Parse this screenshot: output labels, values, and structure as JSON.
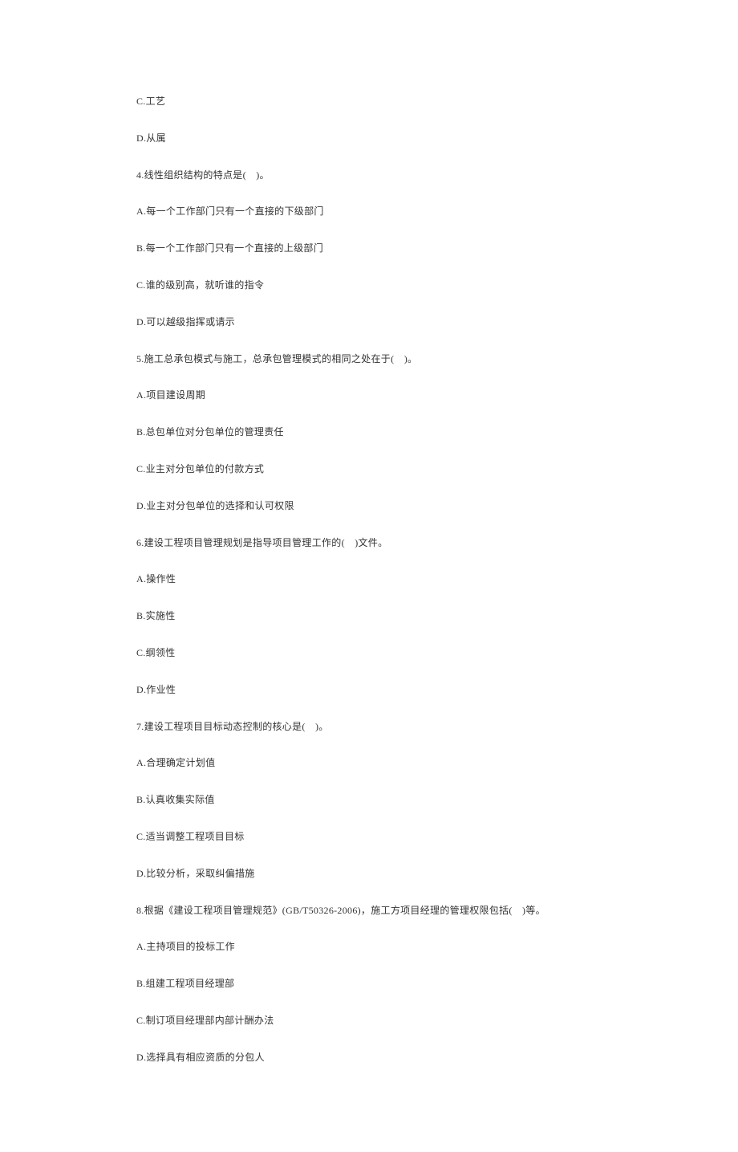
{
  "lines": [
    "C.工艺",
    "D.从属",
    "4.线性组织结构的特点是(　)。",
    "A.每一个工作部门只有一个直接的下级部门",
    "B.每一个工作部门只有一个直接的上级部门",
    "C.谁的级别高，就听谁的指令",
    "D.可以越级指挥或请示",
    "5.施工总承包模式与施工，总承包管理模式的相同之处在于(　)。",
    "A.项目建设周期",
    "B.总包单位对分包单位的管理责任",
    "C.业主对分包单位的付款方式",
    "D.业主对分包单位的选择和认可权限",
    "6.建设工程项目管理规划是指导项目管理工作的(　)文件。",
    "A.操作性",
    "B.实施性",
    "C.纲领性",
    "D.作业性",
    "7.建设工程项目目标动态控制的核心是(　)。",
    "A.合理确定计划值",
    "B.认真收集实际值",
    "C.适当调整工程项目目标",
    "D.比较分析，采取纠偏措施",
    "8.根据《建设工程项目管理规范》(GB/T50326-2006)，施工方项目经理的管理权限包括(　)等。",
    "A.主持项目的投标工作",
    "B.组建工程项目经理部",
    "C.制订项目经理部内部计酬办法",
    "D.选择具有相应资质的分包人"
  ]
}
